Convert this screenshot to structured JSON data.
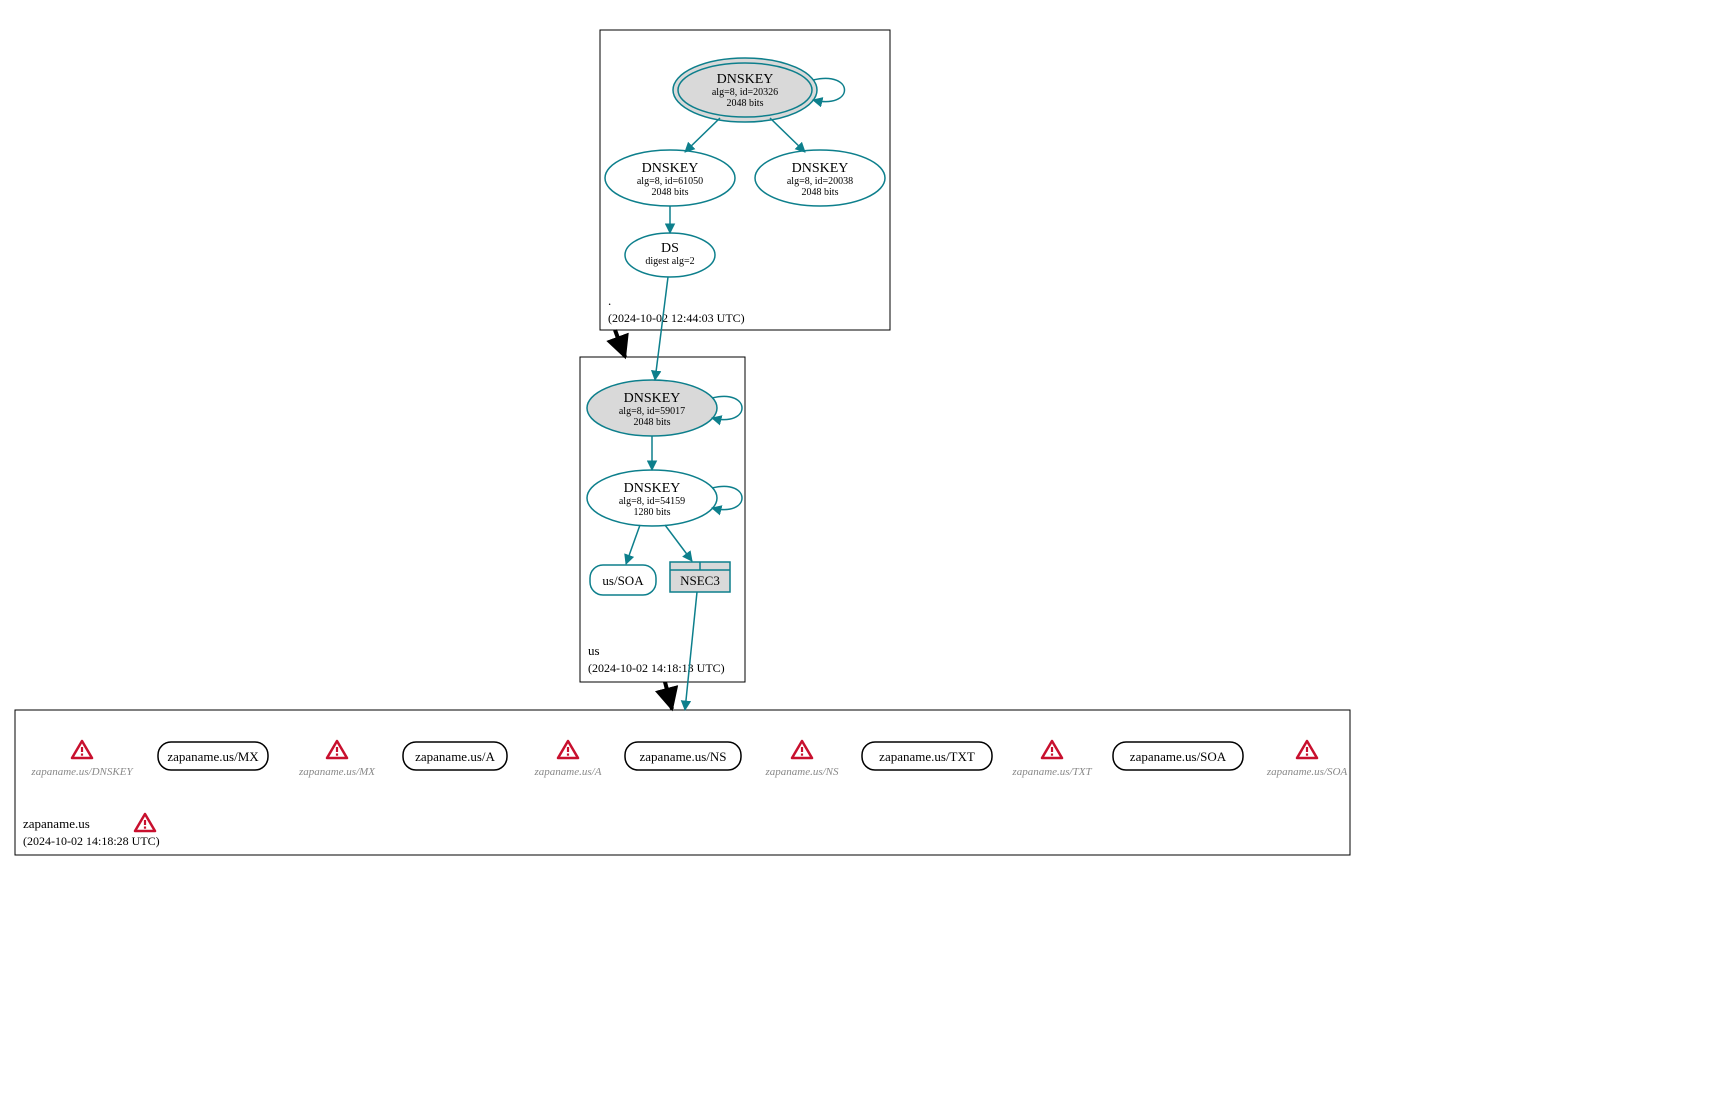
{
  "zones": {
    "root": {
      "label": ".",
      "timestamp": "(2024-10-02 12:44:03 UTC)",
      "dnskey_ksk": {
        "title": "DNSKEY",
        "line1": "alg=8, id=20326",
        "line2": "2048 bits"
      },
      "dnskey_zsk1": {
        "title": "DNSKEY",
        "line1": "alg=8, id=61050",
        "line2": "2048 bits"
      },
      "dnskey_zsk2": {
        "title": "DNSKEY",
        "line1": "alg=8, id=20038",
        "line2": "2048 bits"
      },
      "ds": {
        "title": "DS",
        "line1": "digest alg=2"
      }
    },
    "us": {
      "label": "us",
      "timestamp": "(2024-10-02 14:18:13 UTC)",
      "dnskey_ksk": {
        "title": "DNSKEY",
        "line1": "alg=8, id=59017",
        "line2": "2048 bits"
      },
      "dnskey_zsk": {
        "title": "DNSKEY",
        "line1": "alg=8, id=54159",
        "line2": "1280 bits"
      },
      "soa": {
        "label": "us/SOA"
      },
      "nsec3": {
        "label": "NSEC3"
      }
    },
    "target": {
      "label": "zapaname.us",
      "timestamp": "(2024-10-02 14:18:28 UTC)",
      "records": {
        "mx": "zapaname.us/MX",
        "a": "zapaname.us/A",
        "ns": "zapaname.us/NS",
        "txt": "zapaname.us/TXT",
        "soa": "zapaname.us/SOA"
      },
      "warnings": {
        "dnskey": "zapaname.us/DNSKEY",
        "mx": "zapaname.us/MX",
        "a": "zapaname.us/A",
        "ns": "zapaname.us/NS",
        "txt": "zapaname.us/TXT",
        "soa": "zapaname.us/SOA"
      }
    }
  }
}
